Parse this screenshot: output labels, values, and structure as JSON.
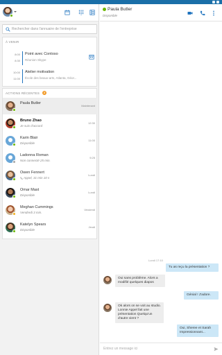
{
  "status_bar": {
    "time": ""
  },
  "me": {
    "status_color": "#6bb700"
  },
  "header_icons": [
    "calendar-icon",
    "dialpad-icon",
    "contacts-icon"
  ],
  "search": {
    "placeholder": "Rechercher dans l'annuaire de l'entreprise"
  },
  "upcoming": {
    "title": "À VENIR",
    "meetings": [
      {
        "start": "8:00",
        "end": "8:30",
        "title": "Point avec Contoso",
        "subtitle": "Réunion Skype"
      },
      {
        "start": "10:00",
        "end": "11:00",
        "title": "Atelier motivation",
        "subtitle": "École des beaux-arts, Atlanta, Géor..."
      }
    ]
  },
  "recent": {
    "title": "ACTIONS RÉCENTES",
    "badge": "2",
    "contacts": [
      {
        "name": "Paula Butler",
        "sub": "",
        "time": "Maintenant",
        "status": "#6bb700",
        "selected": true,
        "bold": false
      },
      {
        "name": "Bruno Zhao",
        "sub": "Je suis d'accord",
        "time": "12:30",
        "status": "#6bb700",
        "selected": false,
        "bold": true
      },
      {
        "name": "Karin Blair",
        "sub": "Disponible",
        "time": "11:00",
        "status": "#6bb700",
        "selected": false,
        "bold": false
      },
      {
        "name": "Ladonna Roman",
        "sub": "Non connecté 25 min.",
        "time": "9:25",
        "status": "#a6a6a6",
        "selected": false,
        "bold": false
      },
      {
        "name": "Owen Fennert",
        "sub": "Appel, 31 min 10 s",
        "time": "Lundi",
        "status": "#6bb700",
        "selected": false,
        "bold": false
      },
      {
        "name": "Omar Mast",
        "sub": "Disponible",
        "time": "Lundi",
        "status": "#6bb700",
        "selected": false,
        "bold": false
      },
      {
        "name": "Meghan Cummings",
        "sub": "Vendredi 3 min.",
        "time": "Vendredi",
        "status": "#f2b01e",
        "selected": false,
        "bold": false
      },
      {
        "name": "Katelyn Spears",
        "sub": "Disponible",
        "time": "Jeudi",
        "status": "#6bb700",
        "selected": false,
        "bold": false
      }
    ]
  },
  "conversation": {
    "contact_name": "Paula Butler",
    "contact_status": "Disponible",
    "day": "Lundi 17:10",
    "messages": [
      {
        "dir": "out",
        "text": "Tu as reçu la présentation ?"
      },
      {
        "dir": "in",
        "text": "Oui sans problème. Alors a modifié quelques diapos"
      },
      {
        "dir": "out",
        "text": "Génial ! J'adore."
      },
      {
        "dir": "in",
        "text": "Ok alors on se voit au studio. Lonnie Appel fait une présentation Quelqu'un d'autre vient ?"
      },
      {
        "dir": "out",
        "text": "Oui, Sheree et Sarah Impressionnant..."
      }
    ],
    "compose_placeholder": "Entrez un message ici"
  },
  "colors": {
    "accent": "#1e73be",
    "statusbar": "#1a6fa8",
    "bubble_out": "#cce7f7",
    "bubble_in": "#ededed"
  }
}
